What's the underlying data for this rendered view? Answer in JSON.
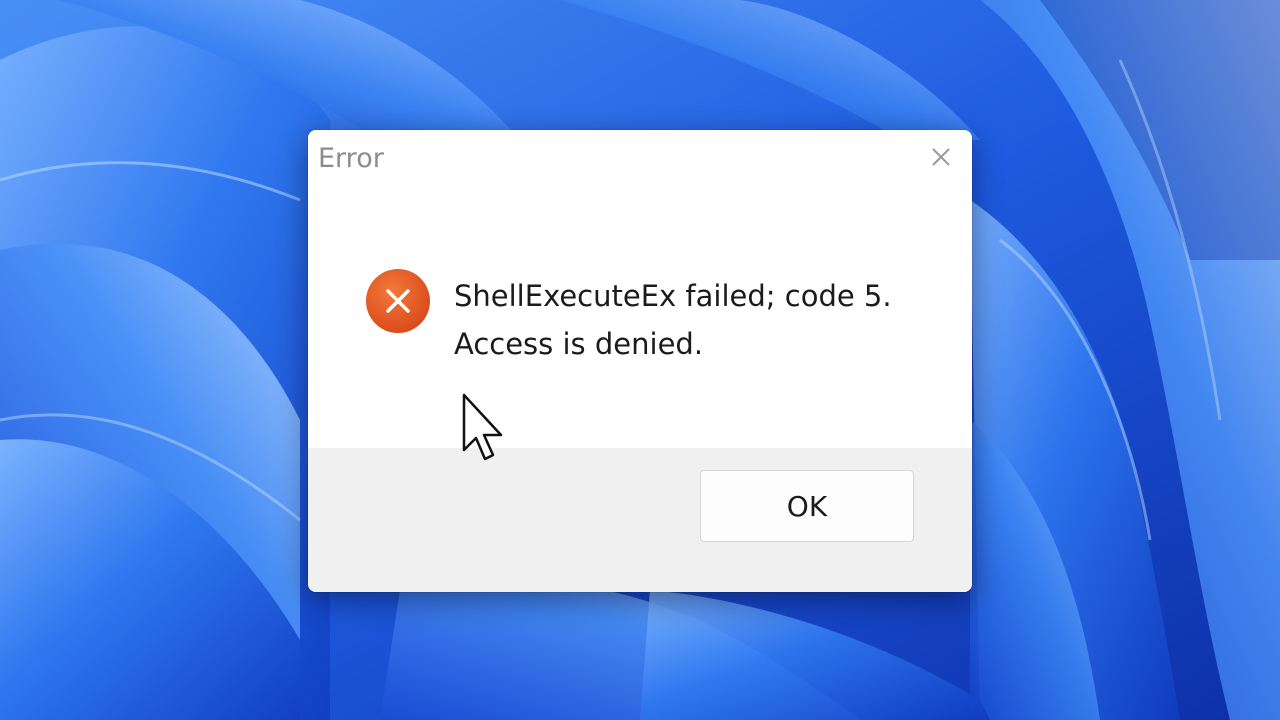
{
  "dialog": {
    "title": "Error",
    "close_icon": "close-icon",
    "error_icon": "error-circle-x-icon",
    "message_line1": "ShellExecuteEx failed; code 5.",
    "message_line2": "Access is denied.",
    "ok_label": "OK"
  },
  "colors": {
    "error_icon": "#e2551b",
    "wallpaper": "#1f5fe0",
    "footer": "#f0f0f0"
  }
}
